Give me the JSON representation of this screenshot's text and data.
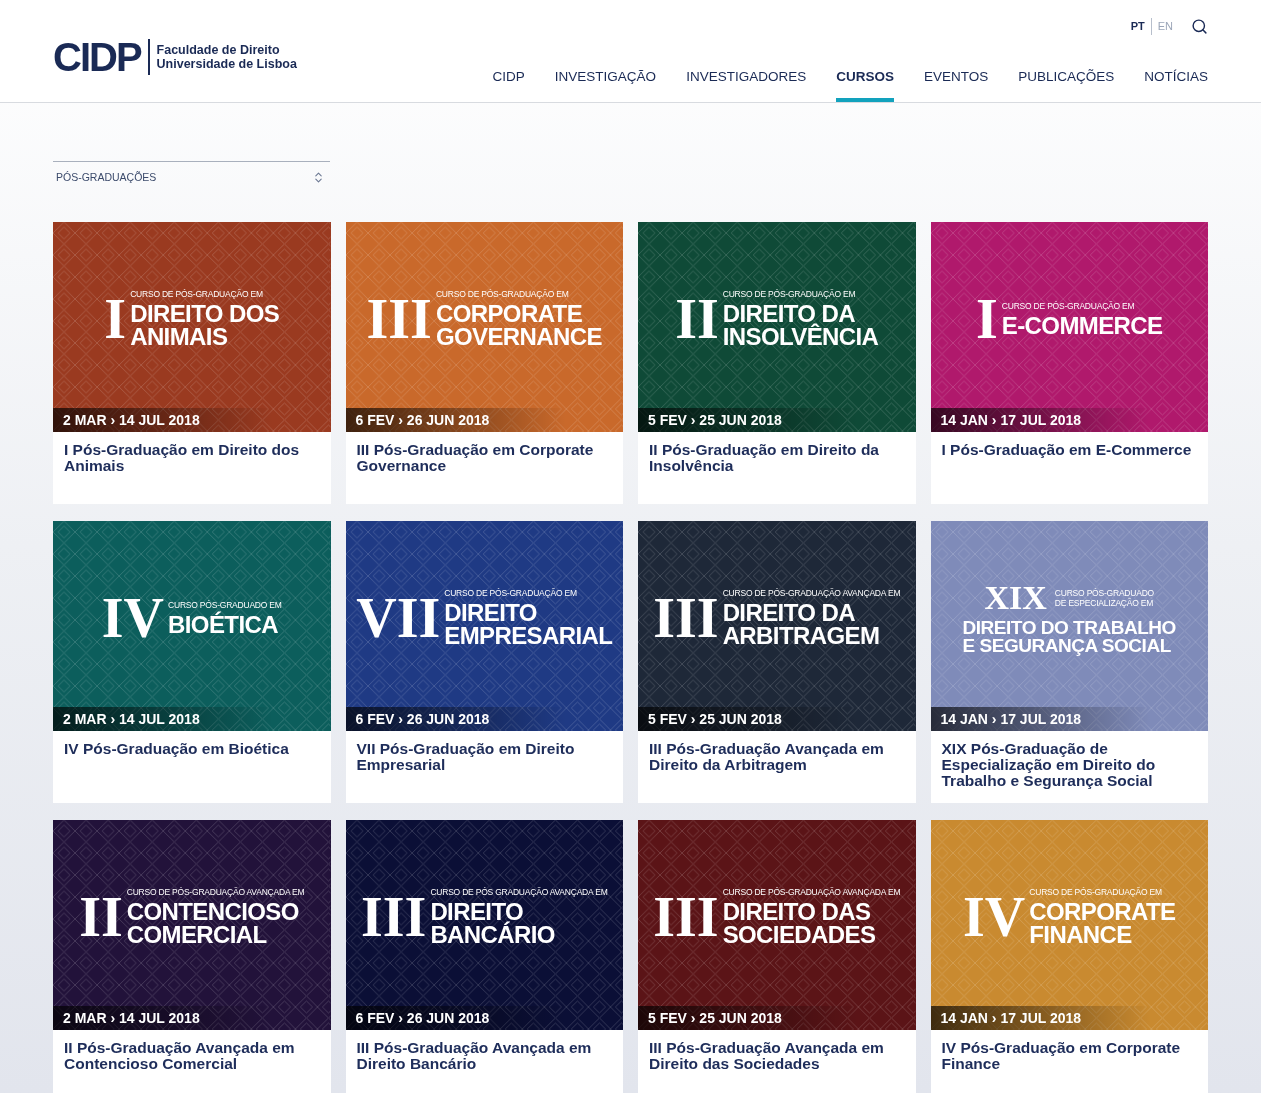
{
  "header": {
    "logo": {
      "mark": "CIDP",
      "lines": [
        "Faculdade de Direito",
        "Universidade de Lisboa"
      ]
    },
    "languages": [
      {
        "label": "PT",
        "selected": true
      },
      {
        "label": "EN",
        "selected": false
      }
    ],
    "nav": [
      {
        "label": "CIDP",
        "selected": false
      },
      {
        "label": "INVESTIGAÇÃO",
        "selected": false
      },
      {
        "label": "INVESTIGADORES",
        "selected": false
      },
      {
        "label": "CURSOS",
        "selected": true
      },
      {
        "label": "EVENTOS",
        "selected": false
      },
      {
        "label": "PUBLICAÇÕES",
        "selected": false
      },
      {
        "label": "NOTÍCIAS",
        "selected": false
      }
    ]
  },
  "filter": {
    "value": "PÓS-GRADUAÇÕES"
  },
  "courses": [
    {
      "banner": {
        "kind": "side",
        "color": "#9a3a20",
        "numeral": "I",
        "subtitle": [
          "CURSO DE PÓS-GRADUAÇÃO EM"
        ],
        "title": [
          "DIREITO DOS",
          "ANIMAIS"
        ]
      },
      "dates": "2 MAR › 14 JUL 2018",
      "title": "I Pós-Graduação em Direito dos Animais"
    },
    {
      "banner": {
        "kind": "side",
        "color": "#c9692b",
        "numeral": "III",
        "subtitle": [
          "CURSO DE PÓS-GRADUAÇÃO EM"
        ],
        "title": [
          "CORPORATE",
          "GOVERNANCE"
        ]
      },
      "dates": "6 FEV › 26 JUN 2018",
      "title": "III Pós-Graduação em Corporate Governance"
    },
    {
      "banner": {
        "kind": "side",
        "color": "#0f4a37",
        "numeral": "II",
        "subtitle": [
          "CURSO DE PÓS-GRADUAÇÃO EM"
        ],
        "title": [
          "DIREITO DA",
          "INSOLVÊNCIA"
        ]
      },
      "dates": "5 FEV › 25 JUN 2018",
      "title": "II Pós-Graduação em Direito da Insolvência"
    },
    {
      "banner": {
        "kind": "side",
        "color": "#b0196c",
        "numeral": "I",
        "subtitle": [
          "CURSO DE PÓS-GRADUAÇÃO EM"
        ],
        "title": [
          "E-COMMERCE"
        ]
      },
      "dates": "14 JAN › 17 JUL 2018",
      "title": "I Pós-Graduação em E-Commerce"
    },
    {
      "banner": {
        "kind": "side",
        "color": "#0c5e5c",
        "numeral": "IV",
        "subtitle": [
          "CURSO PÓS-GRADUADO EM"
        ],
        "title": [
          "BIOÉTICA"
        ]
      },
      "dates": "2 MAR › 14 JUL 2018",
      "title": "IV Pós-Graduação em Bioética"
    },
    {
      "banner": {
        "kind": "side",
        "color": "#1f3a84",
        "numeral": "VII",
        "subtitle": [
          "CURSO DE PÓS-GRADUAÇÃO EM"
        ],
        "title": [
          "DIREITO",
          "EMPRESARIAL"
        ]
      },
      "dates": "6 FEV › 26 JUN 2018",
      "title": "VII Pós-Graduação em Direito Empresarial"
    },
    {
      "banner": {
        "kind": "side",
        "color": "#1e2838",
        "numeral": "III",
        "subtitle": [
          "CURSO DE PÓS-GRADUAÇÃO AVANÇADA EM"
        ],
        "title": [
          "DIREITO DA",
          "ARBITRAGEM"
        ]
      },
      "dates": "5 FEV › 25 JUN 2018",
      "title": "III Pós-Graduação Avançada em Direito da Arbitragem"
    },
    {
      "banner": {
        "kind": "stacked",
        "color": "#7f8bb9",
        "numeral": "XIX",
        "subtitle": [
          "CURSO PÓS-GRADUADO",
          "DE ESPECIALIZAÇÃO EM"
        ],
        "title": [
          "DIREITO DO TRABALHO",
          "E SEGURANÇA SOCIAL"
        ]
      },
      "dates": "14 JAN › 17 JUL 2018",
      "title": "XIX Pós-Graduação de Especialização em Direito do Trabalho e Segurança Social"
    },
    {
      "banner": {
        "kind": "side",
        "color": "#22123a",
        "numeral": "II",
        "subtitle": [
          "CURSO DE PÓS-GRADUAÇÃO AVANÇADA EM"
        ],
        "title": [
          "CONTENCIOSO",
          "COMERCIAL"
        ]
      },
      "dates": "2 MAR › 14 JUL 2018",
      "title": "II Pós-Graduação Avançada em Contencioso Comercial"
    },
    {
      "banner": {
        "kind": "side",
        "color": "#0b0f36",
        "numeral": "III",
        "subtitle": [
          "CURSO DE PÓS GRADUAÇÃO AVANÇADA EM"
        ],
        "title": [
          "DIREITO",
          "BANCÁRIO"
        ]
      },
      "dates": "6 FEV › 26 JUN 2018",
      "title": "III Pós-Graduação Avançada em Direito Bancário"
    },
    {
      "banner": {
        "kind": "side",
        "color": "#5b1417",
        "numeral": "III",
        "subtitle": [
          "CURSO DE PÓS-GRADUAÇÃO AVANÇADA EM"
        ],
        "title": [
          "DIREITO DAS",
          "SOCIEDADES"
        ]
      },
      "dates": "5 FEV › 25 JUN 2018",
      "title": "III Pós-Graduação Avançada em Direito das Sociedades"
    },
    {
      "banner": {
        "kind": "side",
        "color": "#c98a30",
        "numeral": "IV",
        "subtitle": [
          "CURSO DE PÓS-GRADUAÇÃO EM"
        ],
        "title": [
          "CORPORATE",
          "FINANCE"
        ]
      },
      "dates": "14 JAN › 17 JUL 2018",
      "title": "IV Pós-Graduação em Corporate Finance"
    }
  ]
}
